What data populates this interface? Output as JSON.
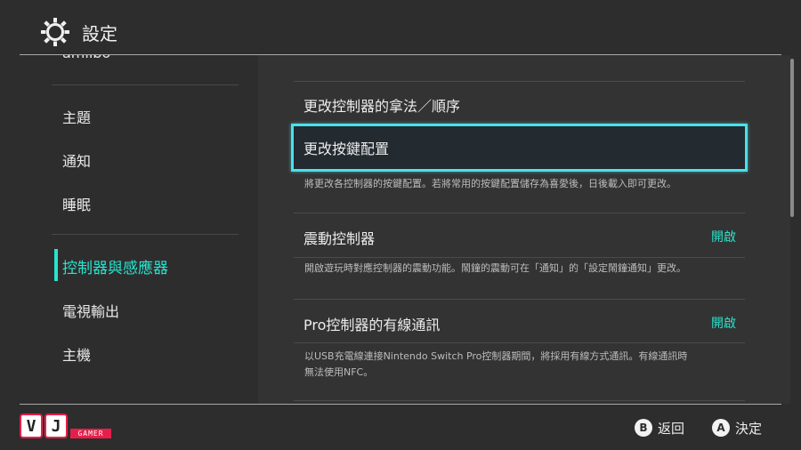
{
  "header": {
    "title": "設定",
    "icon": "gear-icon"
  },
  "sidebar": {
    "partial_item": "amiibo",
    "items": [
      {
        "label": "主題"
      },
      {
        "label": "通知"
      },
      {
        "label": "睡眠"
      },
      {
        "label": "控制器與感應器",
        "active": true
      },
      {
        "label": "電視輸出"
      },
      {
        "label": "主機"
      }
    ]
  },
  "main": {
    "items": [
      {
        "label": "更改控制器的拿法／順序"
      },
      {
        "label": "更改按鍵配置",
        "selected": true,
        "description": "將更改各控制器的按鍵配置。若將常用的按鍵配置儲存為喜愛後，日後載入即可更改。"
      },
      {
        "label": "震動控制器",
        "value": "開啟",
        "description": "開啟遊玩時對應控制器的震動功能。鬧鐘的震動可在「通知」的「設定鬧鐘通知」更改。"
      },
      {
        "label": "Pro控制器的有線通訊",
        "value": "開啟",
        "description_lines": [
          "以USB充電線連接Nintendo Switch Pro控制器期間，將採用有線方式通訊。有線通訊時",
          "無法使用NFC。"
        ]
      }
    ]
  },
  "footer": {
    "logo": {
      "letters": [
        "V",
        "J"
      ],
      "tag": "GAMER"
    },
    "back": {
      "button": "B",
      "label": "返回"
    },
    "ok": {
      "button": "A",
      "label": "決定"
    }
  },
  "colors": {
    "accent": "#29e3d0",
    "selection_border": "#4be1e8",
    "background": "#2d2d2d",
    "logo_red": "#e81e4a"
  }
}
